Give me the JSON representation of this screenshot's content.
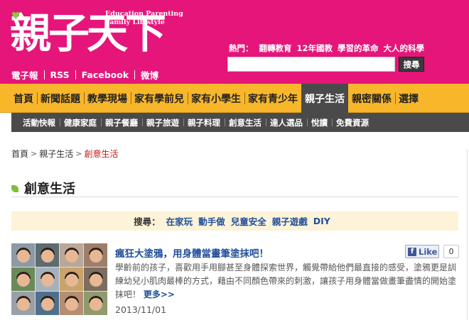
{
  "brand": {
    "logo_text": "親子天下",
    "tagline_line1": "Education  Parenting",
    "tagline_line2": "Family Lifestyle",
    "accent": "#e5157a",
    "nav_bg": "#f8b62b",
    "subnav_bg": "#4a4a4a"
  },
  "quick_links": [
    "電子報",
    "RSS",
    "Facebook",
    "微博"
  ],
  "hot": {
    "label": "熱門：",
    "items": [
      "翻轉教育",
      "12年國教",
      "學習的革命",
      "大人的科學"
    ]
  },
  "search": {
    "value": "",
    "button_label": "搜尋"
  },
  "main_nav": [
    {
      "label": "首頁",
      "active": false
    },
    {
      "label": "新聞話題",
      "active": false
    },
    {
      "label": "教學現場",
      "active": false
    },
    {
      "label": "家有學前兒",
      "active": false
    },
    {
      "label": "家有小學生",
      "active": false
    },
    {
      "label": "家有青少年",
      "active": false
    },
    {
      "label": "親子生活",
      "active": true
    },
    {
      "label": "親密關係",
      "active": false
    },
    {
      "label": "選擇",
      "active": false
    }
  ],
  "sub_nav": [
    "活動快報",
    "健康家庭",
    "親子餐廳",
    "親子旅遊",
    "親子料理",
    "創意生活",
    "達人選品",
    "悅讀",
    "免費資源"
  ],
  "breadcrumb": {
    "home": "首頁",
    "parent": "親子生活",
    "current": "創意生活",
    "sep": ">"
  },
  "section": {
    "title": "創意生活"
  },
  "tag_search": {
    "label": "搜尋：",
    "tags": [
      "在家玩",
      "動手做",
      "兒童安全",
      "親子遊戲",
      "DIY"
    ]
  },
  "article": {
    "title": "瘋狂大塗鴉，用身體當畫筆塗抹吧！",
    "summary": "學齡前的孩子，喜歡用手用腳甚至身體探索世界，觸覺帶給他們最直接的感受，塗鴉更是訓練幼兒小肌肉最棒的方式，藉由不同顏色帶來的刺激，讓孩子用身體當做畫筆盡情的開始塗抹吧！",
    "more_label": "更多>>",
    "date": "2013/11/01",
    "like_label": "Like",
    "like_count": "0",
    "fb_icon_glyph": "f"
  }
}
